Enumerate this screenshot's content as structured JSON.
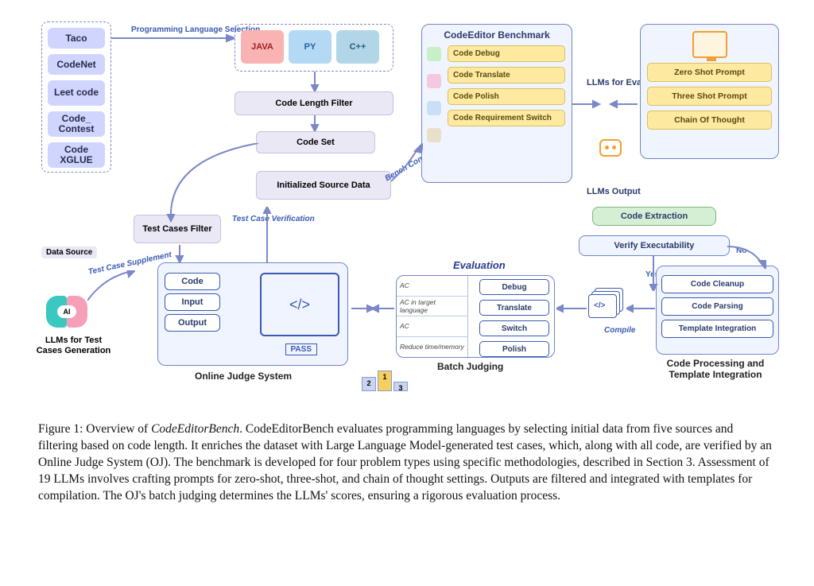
{
  "sources": {
    "taco": "Taco",
    "codenet": "CodeNet",
    "leet": "Leet code",
    "contest": "Code_ Contest",
    "xglue": "Code XGLUE"
  },
  "data_source_label": "Data Source",
  "prog_lang_label": "Programming Language Selection",
  "langs": {
    "java": "JAVA",
    "py": "PY",
    "cpp": "C++"
  },
  "pipeline": {
    "code_length_filter": "Code Length Filter",
    "code_set": "Code Set",
    "init_source_data": "Initialized Source Data",
    "test_cases_filter": "Test Cases Filter"
  },
  "annotations": {
    "test_case_supplement": "Test Case Supplement",
    "test_case_verification": "Test Case Verification",
    "bench_construct": "Bench Construct",
    "yes": "Yes",
    "no": "No",
    "compile": "Compile"
  },
  "llm_gen_label": "LLMs for Test Cases Generation",
  "brain_ai": "AI",
  "oj": {
    "code": "Code",
    "input": "Input",
    "output": "Output",
    "pass": "PASS",
    "code_tag": "</>",
    "title": "Online Judge System"
  },
  "benchmark": {
    "title": "CodeEditor Benchmark",
    "items": [
      "Code Debug",
      "Code Translate",
      "Code Polish",
      "Code Requirement Switch"
    ]
  },
  "llm_eval_label": "LLMs for Evaluation",
  "llm_output_label": "LLMs Output",
  "prompts": {
    "items": [
      "Zero Shot Prompt",
      "Three Shot Prompt",
      "Chain Of Thought"
    ]
  },
  "code_extraction": "Code Extraction",
  "verify_exec": "Verify Executability",
  "evaluation_label": "Evaluation",
  "batch": {
    "criteria": [
      "AC",
      "AC in target language",
      "AC",
      "Reduce time/memory"
    ],
    "items": [
      "Debug",
      "Translate",
      "Switch",
      "Polish"
    ],
    "title": "Batch Judging"
  },
  "processing": {
    "items": [
      "Code Cleanup",
      "Code Parsing",
      "Template Integration"
    ],
    "title": "Code Processing and Template Integration"
  },
  "podium": {
    "p1": "1",
    "p2": "2",
    "p3": "3"
  },
  "caption": {
    "label": "Figure 1: Overview of ",
    "emph": "CodeEditorBench",
    "body": ". CodeEditorBench evaluates programming languages by selecting initial data from five sources and filtering based on code length. It enriches the dataset with Large Language Model-generated test cases, which, along with all code, are verified by an Online Judge System (OJ). The benchmark is developed for four problem types using specific methodologies, described in Section 3. Assessment of 19 LLMs involves crafting prompts for zero-shot, three-shot, and chain of thought settings. Outputs are filtered and integrated with templates for compilation. The OJ's batch judging determines the LLMs' scores, ensuring a rigorous evaluation process."
  }
}
